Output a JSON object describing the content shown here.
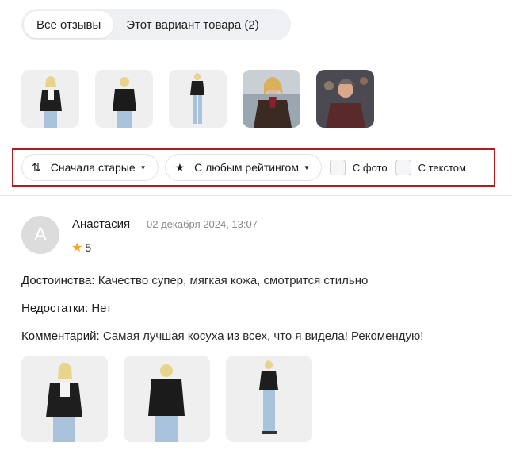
{
  "tabs": [
    {
      "label": "Все отзывы",
      "active": true
    },
    {
      "label": "Этот вариант товара (2)",
      "active": false
    }
  ],
  "filters": {
    "sort_label": "Сначала старые",
    "rating_label": "С любым рейтингом",
    "with_photo_label": "С фото",
    "with_text_label": "С текстом"
  },
  "review": {
    "avatar_letter": "А",
    "author": "Анастасия",
    "date": "02 декабря 2024, 13:07",
    "rating": "5",
    "pros_label": "Достоинства:",
    "pros_text": "Качество супер, мягкая кожа, смотрится стильно",
    "cons_label": "Недостатки:",
    "cons_text": "Нет",
    "comment_label": "Комментарий:",
    "comment_text": "Самая лучшая косуха из всех, что я видела! Рекомендую!"
  },
  "colors": {
    "highlight_border": "#b11d1d",
    "star": "#f5a623",
    "tab_bg": "#eef0f3"
  }
}
